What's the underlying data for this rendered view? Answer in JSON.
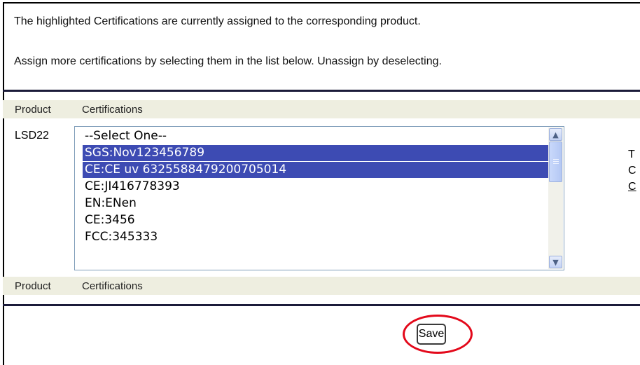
{
  "intro": {
    "line1": "The highlighted Certifications are currently assigned to the corresponding product.",
    "line2": "Assign more certifications by selecting them in the list below. Unassign by deselecting."
  },
  "table": {
    "headers": [
      "Product",
      "Certifications"
    ],
    "footers": [
      "Product",
      "Certifications"
    ],
    "product": "LSD22"
  },
  "certifications": {
    "options": [
      {
        "label": "--Select One--",
        "selected": false
      },
      {
        "label": "SGS:Nov123456789",
        "selected": true
      },
      {
        "label": "CE:CE uv 6325588479200705014",
        "selected": true
      },
      {
        "label": "CE:JI416778393",
        "selected": false
      },
      {
        "label": "EN:ENen",
        "selected": false
      },
      {
        "label": "CE:3456",
        "selected": false
      },
      {
        "label": "FCC:345333",
        "selected": false
      }
    ]
  },
  "side_column": {
    "line1": "T",
    "line2": "C",
    "link": "C"
  },
  "actions": {
    "save_label": "Save"
  },
  "colors": {
    "selection": "#3d4bb3",
    "header_bg": "#eeeee0",
    "highlight_ring": "#e3081a"
  }
}
